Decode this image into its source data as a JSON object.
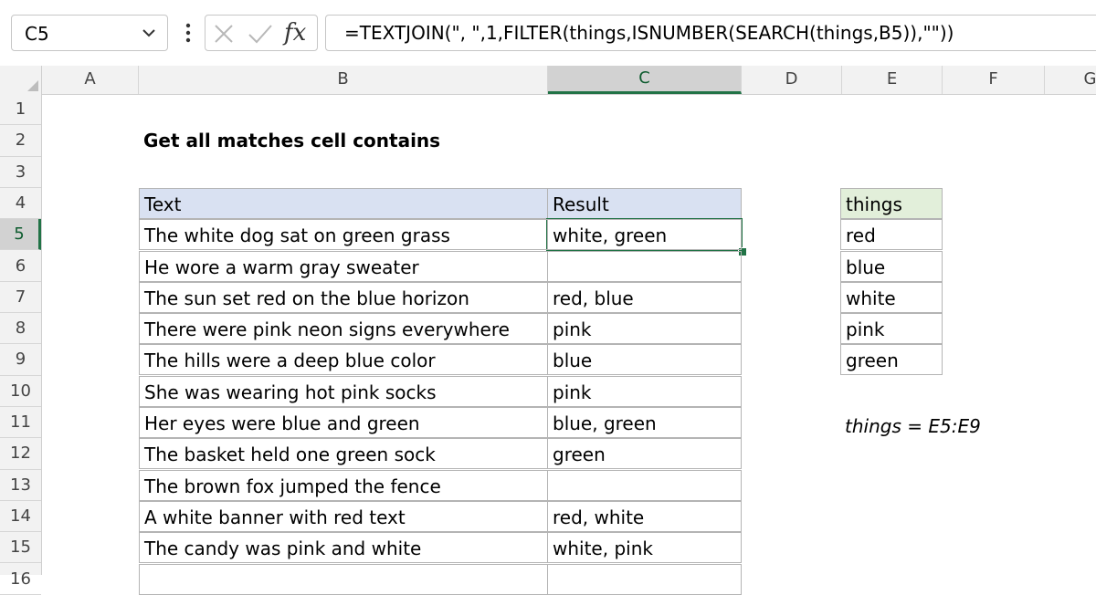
{
  "formula_bar": {
    "name_box": "C5",
    "fx_label": "fx",
    "formula": "=TEXTJOIN(\", \",1,FILTER(things,ISNUMBER(SEARCH(things,B5)),\"\"))"
  },
  "columns": [
    {
      "label": "A",
      "active": false
    },
    {
      "label": "B",
      "active": false
    },
    {
      "label": "C",
      "active": true
    },
    {
      "label": "D",
      "active": false
    },
    {
      "label": "E",
      "active": false
    },
    {
      "label": "F",
      "active": false
    },
    {
      "label": "G",
      "active": false
    }
  ],
  "rows": [
    "1",
    "2",
    "3",
    "4",
    "5",
    "6",
    "7",
    "8",
    "9",
    "10",
    "11",
    "12",
    "13",
    "14",
    "15",
    "16"
  ],
  "active_cell": {
    "col": "C",
    "row": "5"
  },
  "sheet": {
    "title": "Get all matches cell contains",
    "table_headers": {
      "text": "Text",
      "result": "Result"
    },
    "table_rows": [
      {
        "text": "The white dog sat on green grass",
        "result": "white, green"
      },
      {
        "text": "He wore a warm gray sweater",
        "result": ""
      },
      {
        "text": "The sun set red on the blue horizon",
        "result": "red, blue"
      },
      {
        "text": "There were pink neon signs everywhere",
        "result": "pink"
      },
      {
        "text": "The hills were a deep blue color",
        "result": "blue"
      },
      {
        "text": "She was wearing hot pink socks",
        "result": "pink"
      },
      {
        "text": "Her eyes were blue and green",
        "result": "blue, green"
      },
      {
        "text": "The basket held one green sock",
        "result": "green"
      },
      {
        "text": "The brown fox jumped the fence",
        "result": ""
      },
      {
        "text": "A white banner with red text",
        "result": "red, white"
      },
      {
        "text": "The candy was pink and white",
        "result": "white, pink"
      }
    ],
    "things_header": "things",
    "things": [
      "red",
      "blue",
      "white",
      "pink",
      "green"
    ],
    "named_range_note": "things = E5:E9"
  },
  "colors": {
    "accent_green": "#217346",
    "header_blue": "#d9e1f2",
    "header_green": "#e2efda",
    "gridline": "#b4b4b4"
  },
  "icons": {
    "name_box_dropdown": "chevron-down-icon",
    "more": "vertical-dots-icon",
    "cancel": "x-icon",
    "enter": "check-icon",
    "function": "fx-icon"
  }
}
